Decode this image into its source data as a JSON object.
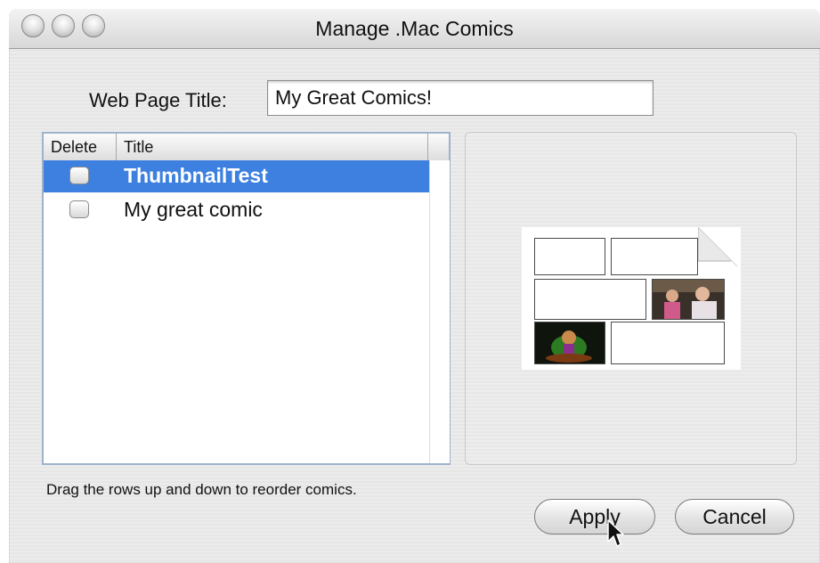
{
  "window": {
    "title": "Manage .Mac Comics"
  },
  "form": {
    "web_page_title_label": "Web Page Title:",
    "web_page_title_value": "My Great Comics!"
  },
  "table": {
    "headers": {
      "delete": "Delete",
      "title": "Title"
    },
    "rows": [
      {
        "title": "ThumbnailTest",
        "delete": false,
        "selected": true
      },
      {
        "title": "My great comic",
        "delete": false,
        "selected": false
      }
    ]
  },
  "hint": "Drag the rows up and down to reorder comics.",
  "buttons": {
    "apply": "Apply",
    "cancel": "Cancel"
  },
  "colors": {
    "selection": "#3d80df",
    "table_border": "#9fb2cc"
  },
  "icons": {
    "traffic_lights": [
      "close-button-icon",
      "minimize-button-icon",
      "zoom-button-icon"
    ],
    "cursor": "arrow-cursor-icon"
  }
}
